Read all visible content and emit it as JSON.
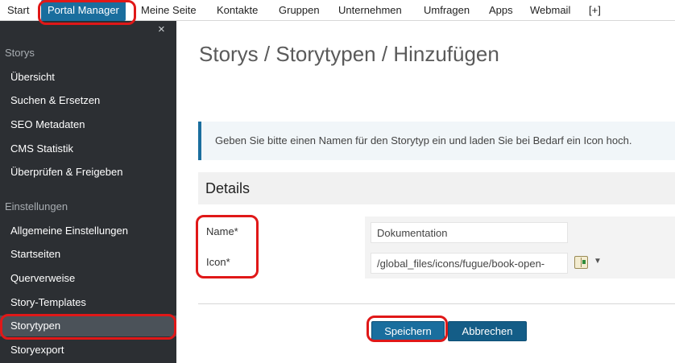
{
  "topnav": {
    "items": [
      {
        "label": "Start"
      },
      {
        "label": "Portal Manager",
        "active": true
      },
      {
        "label": "Meine Seite"
      },
      {
        "label": "Kontakte"
      },
      {
        "label": "Gruppen"
      },
      {
        "label": "Unternehmen"
      },
      {
        "label": "Umfragen"
      },
      {
        "label": "Apps"
      },
      {
        "label": "Webmail"
      },
      {
        "label": "[+]"
      }
    ]
  },
  "sidebar": {
    "close_label": "×",
    "sections": [
      {
        "title": "Storys",
        "items": [
          {
            "label": "Übersicht"
          },
          {
            "label": "Suchen & Ersetzen"
          },
          {
            "label": "SEO Metadaten"
          },
          {
            "label": "CMS Statistik"
          },
          {
            "label": "Überprüfen & Freigeben"
          }
        ]
      },
      {
        "title": "Einstellungen",
        "items": [
          {
            "label": "Allgemeine Einstellungen"
          },
          {
            "label": "Startseiten"
          },
          {
            "label": "Querverweise"
          },
          {
            "label": "Story-Templates"
          },
          {
            "label": "Storytypen",
            "active": true
          },
          {
            "label": "Storyexport"
          }
        ]
      }
    ]
  },
  "main": {
    "title": "Storys / Storytypen / Hinzufügen",
    "info": "Geben Sie bitte einen Namen für den Storytyp ein und laden Sie bei Bedarf ein Icon hoch.",
    "details_heading": "Details",
    "form": {
      "name_label": "Name*",
      "name_value": "Dokumentation",
      "icon_label": "Icon*",
      "icon_value": "/global_files/icons/fugue/book-open-",
      "icon_name": "book-open-icon"
    },
    "buttons": {
      "save_label": "Speichern",
      "cancel_label": "Abbrechen"
    }
  },
  "colors": {
    "accent": "#1a6e9e",
    "sidebar_bg": "#2c2f33",
    "sidebar_active": "#4b5259",
    "annotation": "#e01818"
  }
}
